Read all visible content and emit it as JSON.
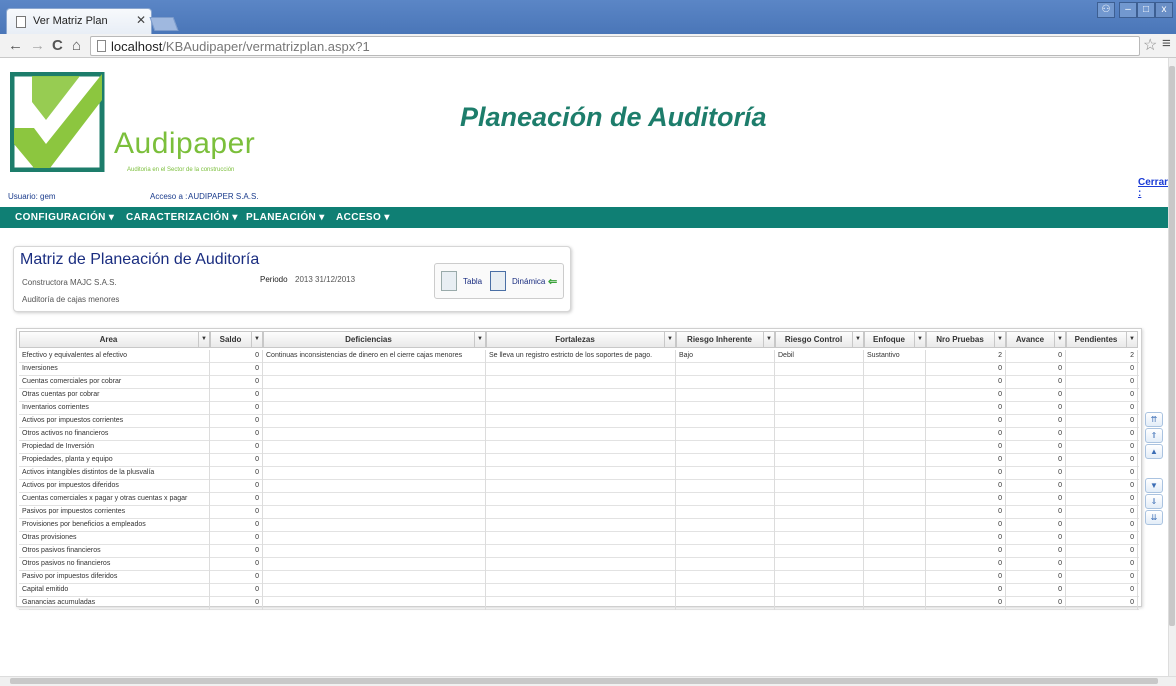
{
  "browser": {
    "tab_title": "Ver Matriz Plan",
    "url_host": "localhost",
    "url_path": "/KBAudipaper/vermatrizplan.aspx?1"
  },
  "header": {
    "brand": "Audipaper",
    "tagline": "Auditoria en el Sector de la construcción",
    "page_title": "Planeación de Auditoría",
    "user_label": "Usuario:",
    "user_value": "gem",
    "access_label": "Acceso a :",
    "access_value": "AUDIPAPER S.A.S.",
    "logout": "Cerrar :"
  },
  "menu": {
    "items": [
      "CONFIGURACIÓN ▾",
      "CARACTERIZACIÓN ▾",
      "PLANEACIÓN ▾",
      "ACCESO ▾"
    ]
  },
  "info": {
    "title": "Matriz de Planeación de Auditoría",
    "company": "Constructora MAJC S.A.S.",
    "audit": "Auditoría de cajas menores",
    "period_label": "Periodo",
    "period_value": "2013  31/12/2013",
    "view_table": "Tabla",
    "view_dynamic": "Dinámica"
  },
  "grid": {
    "columns": [
      "Area",
      "Saldo",
      "Deficiencias",
      "Fortalezas",
      "Riesgo Inherente",
      "Riesgo Control",
      "Enfoque",
      "Nro Pruebas",
      "Avance",
      "Pendientes"
    ],
    "rows": [
      [
        "Efectivo y equivalentes al efectivo",
        "0",
        "Continuas inconsistencias de dinero en el cierre cajas menores",
        "Se lleva un registro estricto de los soportes de pago.",
        "Bajo",
        "Debil",
        "Sustantivo",
        "2",
        "0",
        "2"
      ],
      [
        "Inversiones",
        "0",
        "",
        "",
        "",
        "",
        "",
        "0",
        "0",
        "0"
      ],
      [
        "Cuentas comerciales por cobrar",
        "0",
        "",
        "",
        "",
        "",
        "",
        "0",
        "0",
        "0"
      ],
      [
        "Otras cuentas por cobrar",
        "0",
        "",
        "",
        "",
        "",
        "",
        "0",
        "0",
        "0"
      ],
      [
        "Inventarios corrientes",
        "0",
        "",
        "",
        "",
        "",
        "",
        "0",
        "0",
        "0"
      ],
      [
        "Activos por impuestos corrientes",
        "0",
        "",
        "",
        "",
        "",
        "",
        "0",
        "0",
        "0"
      ],
      [
        "Otros activos no financieros",
        "0",
        "",
        "",
        "",
        "",
        "",
        "0",
        "0",
        "0"
      ],
      [
        "Propiedad de Inversión",
        "0",
        "",
        "",
        "",
        "",
        "",
        "0",
        "0",
        "0"
      ],
      [
        "Propiedades, planta y equipo",
        "0",
        "",
        "",
        "",
        "",
        "",
        "0",
        "0",
        "0"
      ],
      [
        "Activos intangibles distintos de la plusvalía",
        "0",
        "",
        "",
        "",
        "",
        "",
        "0",
        "0",
        "0"
      ],
      [
        "Activos por impuestos diferidos",
        "0",
        "",
        "",
        "",
        "",
        "",
        "0",
        "0",
        "0"
      ],
      [
        "Cuentas comerciales x pagar y otras cuentas x pagar",
        "0",
        "",
        "",
        "",
        "",
        "",
        "0",
        "0",
        "0"
      ],
      [
        "Pasivos por impuestos corrientes",
        "0",
        "",
        "",
        "",
        "",
        "",
        "0",
        "0",
        "0"
      ],
      [
        "Provisiones por beneficios a empleados",
        "0",
        "",
        "",
        "",
        "",
        "",
        "0",
        "0",
        "0"
      ],
      [
        "Otras provisiones",
        "0",
        "",
        "",
        "",
        "",
        "",
        "0",
        "0",
        "0"
      ],
      [
        "Otros pasivos financieros",
        "0",
        "",
        "",
        "",
        "",
        "",
        "0",
        "0",
        "0"
      ],
      [
        "Otros pasivos no financieros",
        "0",
        "",
        "",
        "",
        "",
        "",
        "0",
        "0",
        "0"
      ],
      [
        "Pasivo por impuestos diferidos",
        "0",
        "",
        "",
        "",
        "",
        "",
        "0",
        "0",
        "0"
      ],
      [
        "Capital emitido",
        "0",
        "",
        "",
        "",
        "",
        "",
        "0",
        "0",
        "0"
      ],
      [
        "Ganancias acumuladas",
        "0",
        "",
        "",
        "",
        "",
        "",
        "0",
        "0",
        "0"
      ]
    ]
  },
  "pager": {
    "buttons": [
      "⇈",
      "⇑",
      "▲",
      "▼",
      "⇓",
      "⇊"
    ]
  }
}
